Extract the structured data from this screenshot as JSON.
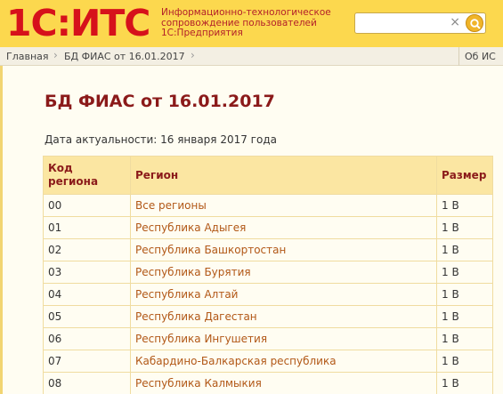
{
  "header": {
    "logo": "1С:ИТС",
    "tagline": [
      "Информационно-технологическое",
      "сопровождение пользователей",
      "1С:Предприятия"
    ],
    "search_placeholder": "",
    "search_clear": "×"
  },
  "breadcrumb": {
    "items": [
      "Главная",
      "БД ФИАС от 16.01.2017"
    ],
    "right": "Об ИС"
  },
  "page": {
    "title": "БД ФИАС от 16.01.2017",
    "date_line": "Дата актуальности: 16 января 2017 года"
  },
  "table": {
    "headers": [
      "Код региона",
      "Регион",
      "Размер"
    ],
    "rows": [
      {
        "code": "00",
        "region": "Все регионы",
        "size": "1 B"
      },
      {
        "code": "01",
        "region": "Республика Адыгея",
        "size": "1 B"
      },
      {
        "code": "02",
        "region": "Республика Башкортостан",
        "size": "1 B"
      },
      {
        "code": "03",
        "region": "Республика Бурятия",
        "size": "1 B"
      },
      {
        "code": "04",
        "region": "Республика Алтай",
        "size": "1 B"
      },
      {
        "code": "05",
        "region": "Республика Дагестан",
        "size": "1 B"
      },
      {
        "code": "06",
        "region": "Республика Ингушетия",
        "size": "1 B"
      },
      {
        "code": "07",
        "region": "Кабардино-Балкарская республика",
        "size": "1 B"
      },
      {
        "code": "08",
        "region": "Республика Калмыкия",
        "size": "1 B"
      }
    ]
  }
}
